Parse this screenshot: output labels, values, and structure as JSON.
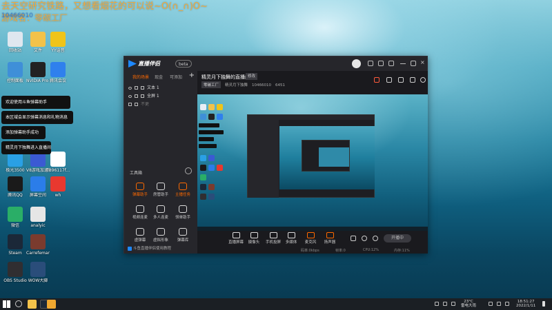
{
  "banner": {
    "line1": "去天空研究铁路，又想看烟花的可以说~O(∩_∩)O~",
    "line2": "游戏名：零碳工厂",
    "room_id": "10466010"
  },
  "desktop": {
    "icons": [
      {
        "label": "回收站",
        "color": "#dfe7ef"
      },
      {
        "label": "文件",
        "color": "#f3c24a"
      },
      {
        "label": "YY语音",
        "color": "#f0c419"
      },
      {
        "label": "控制面板",
        "color": "#3f8fd8"
      },
      {
        "label": "NVIDIA Pro GameS...",
        "color": "#222222"
      },
      {
        "label": "腾讯会议",
        "color": "#2f80ed"
      },
      {
        "label": "极光3500",
        "color": "#2aa0e5"
      },
      {
        "label": "V8游戏加速器",
        "color": "#3b5ad3"
      },
      {
        "label": "7896117f...",
        "color": "#ffffff"
      },
      {
        "label": "腾讯QQ",
        "color": "#1a1a1a"
      },
      {
        "label": "屏幕空间",
        "color": "#2b7de9"
      },
      {
        "label": "wh",
        "color": "#e8382f"
      },
      {
        "label": "微信",
        "color": "#2aae67"
      },
      {
        "label": "analyic",
        "color": "#e6e6e6"
      },
      {
        "label": "Steam",
        "color": "#1b2838"
      },
      {
        "label": "Carrefeman The Comi...",
        "color": "#7a3b2e"
      },
      {
        "label": "OBS Studio",
        "color": "#302e31"
      },
      {
        "label": "WOW大脚",
        "color": "#2a4d7a"
      }
    ]
  },
  "toasts": [
    "欢迎使用斗鱼弹幕助手",
    "本区域会显示弹幕消息和礼物消息",
    "添加弹幕助手成功",
    "精灵月下独舞进入直播间"
  ],
  "app": {
    "brand": "直播伴侣",
    "version": "beta",
    "tabs": [
      "我的场景",
      "现金",
      "可添加"
    ],
    "sources": [
      {
        "label": "文本 1"
      },
      {
        "label": "全屏 1"
      },
      {
        "label": "不更"
      }
    ],
    "tools_title": "工具箱",
    "tools": [
      {
        "label": "弹幕助手",
        "orange": true
      },
      {
        "label": "房管助手",
        "orange": false
      },
      {
        "label": "主播任务",
        "orange": true
      },
      {
        "label": "视频连麦",
        "orange": false
      },
      {
        "label": "多人连麦",
        "orange": false
      },
      {
        "label": "领单助手",
        "orange": false
      },
      {
        "label": "虚弹幕",
        "orange": false
      },
      {
        "label": "虚拟形象",
        "orange": false
      },
      {
        "label": "弹幕库",
        "orange": false
      }
    ],
    "sidebar_bottom": "斗鱼直播伴侣使用教程",
    "room_title": "精灵月下独舞的直播间",
    "room_edit": "修改",
    "room_category": "零碳工厂",
    "room_owner": "精灵月下独舞",
    "room_id": "10466010",
    "room_hot": "6451",
    "controls": [
      {
        "label": "直播屏幕",
        "orange": false
      },
      {
        "label": "摄像头",
        "orange": false
      },
      {
        "label": "手机投屏",
        "orange": false
      },
      {
        "label": "多媒体",
        "orange": false
      },
      {
        "label": "麦克风",
        "orange": true
      },
      {
        "label": "扬声器",
        "orange": true
      }
    ],
    "start_label": "开播中",
    "status": [
      "码率:0kbps",
      "帧率:0",
      "CPU:12%",
      "内存:11%"
    ]
  },
  "taskbar": {
    "temp": "23°C",
    "weather": "雷电大雨",
    "time": "18:51:27",
    "date": "2022/1/11"
  }
}
